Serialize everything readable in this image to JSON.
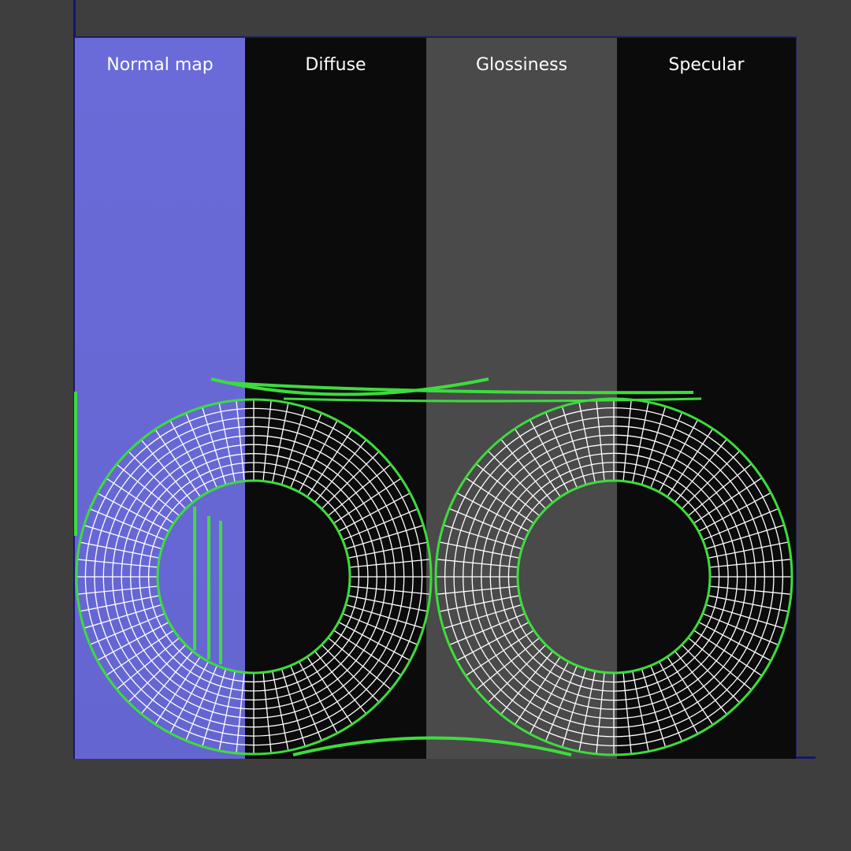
{
  "panels": {
    "normal_map": {
      "label": "Normal map",
      "color": "#6767d6"
    },
    "diffuse": {
      "label": "Diffuse",
      "color": "#0b0b0b"
    },
    "glossiness": {
      "label": "Glossiness",
      "color": "#4a4a4a"
    },
    "specular": {
      "label": "Specular",
      "color": "#0b0b0b"
    }
  },
  "colors": {
    "background": "#3e3e3e",
    "axis": "#15186a",
    "wire": "#ffffff",
    "uv_edge": "#3ddc3d"
  }
}
